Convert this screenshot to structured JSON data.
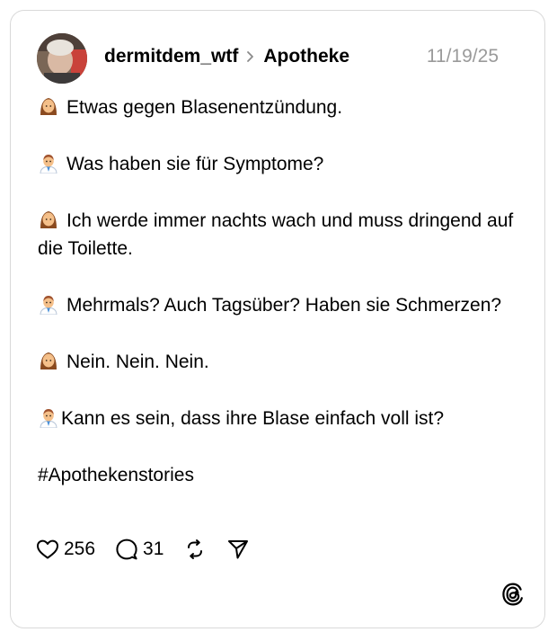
{
  "post": {
    "username": "dermitdem_wtf",
    "community": "Apotheke",
    "date": "11/19/25",
    "lines": [
      {
        "speaker": "woman",
        "icon": "woman-emoji-icon",
        "text": "Etwas gegen Blasenentzündung."
      },
      {
        "speaker": "pharmacist",
        "icon": "pharmacist-emoji-icon",
        "text": "Was haben sie für Symptome?"
      },
      {
        "speaker": "woman",
        "icon": "woman-emoji-icon",
        "text": "Ich werde immer nachts wach und muss dringend auf die Toilette."
      },
      {
        "speaker": "pharmacist",
        "icon": "pharmacist-emoji-icon",
        "text": "Mehrmals? Auch Tagsüber? Haben sie Schmerzen?"
      },
      {
        "speaker": "woman",
        "icon": "woman-emoji-icon",
        "text": "Nein. Nein. Nein."
      },
      {
        "speaker": "pharmacist",
        "icon": "pharmacist-emoji-icon",
        "text": "Kann es sein, dass ihre Blase einfach voll ist?"
      }
    ],
    "hashtag": "#Apothekenstories"
  },
  "actions": {
    "likes": "256",
    "replies": "31",
    "like_icon": "heart-icon",
    "reply_icon": "comment-icon",
    "repost_icon": "repost-icon",
    "share_icon": "send-icon"
  },
  "branding": {
    "logo": "threads-logo-icon"
  },
  "colors": {
    "border": "#d9d9d9",
    "date": "#9a9a9a",
    "text": "#000000"
  }
}
